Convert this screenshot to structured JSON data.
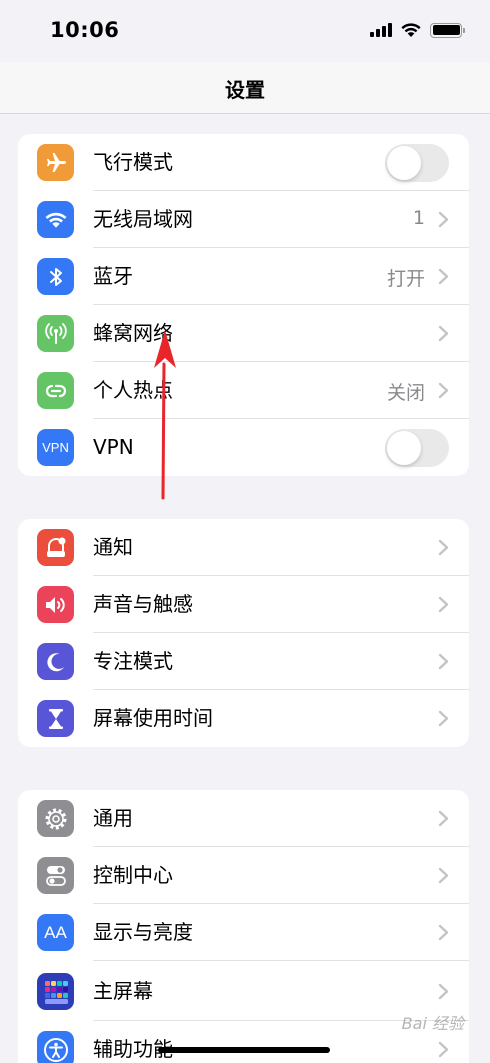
{
  "status_bar": {
    "time": "10:06"
  },
  "nav": {
    "title": "设置"
  },
  "colors": {
    "airplane": "#f19a38",
    "wifi": "#3478f6",
    "bluetooth": "#3478f6",
    "cellular": "#65c466",
    "hotspot": "#65c466",
    "vpn": "#3478f6",
    "notifications": "#eb4e3d",
    "sounds": "#eb445a",
    "focus": "#5856d6",
    "screen_time": "#5856d6",
    "general": "#8e8e93",
    "control_center": "#8e8e93",
    "display": "#3478f6",
    "home_screen": "#2c3db8",
    "accessibility": "#3478f6",
    "arrow": "#e8252a"
  },
  "group1": [
    {
      "label": "飞行模式",
      "icon": "airplane-icon",
      "control": "toggle",
      "on": false
    },
    {
      "label": "无线局域网",
      "icon": "wifi-icon",
      "value": "1"
    },
    {
      "label": "蓝牙",
      "icon": "bluetooth-icon",
      "value": "打开"
    },
    {
      "label": "蜂窝网络",
      "icon": "cellular-icon",
      "value": ""
    },
    {
      "label": "个人热点",
      "icon": "hotspot-icon",
      "value": "关闭"
    },
    {
      "label": "VPN",
      "icon": "vpn-icon",
      "icon_text": "VPN",
      "control": "toggle",
      "on": false
    }
  ],
  "group2": [
    {
      "label": "通知",
      "icon": "notifications-icon"
    },
    {
      "label": "声音与触感",
      "icon": "sounds-icon"
    },
    {
      "label": "专注模式",
      "icon": "moon-icon"
    },
    {
      "label": "屏幕使用时间",
      "icon": "hourglass-icon"
    }
  ],
  "group3": [
    {
      "label": "通用",
      "icon": "gear-icon"
    },
    {
      "label": "控制中心",
      "icon": "switches-icon"
    },
    {
      "label": "显示与亮度",
      "icon": "text-size-icon",
      "icon_text": "AA"
    },
    {
      "label": "主屏幕",
      "icon": "home-grid-icon"
    },
    {
      "label": "辅助功能",
      "icon": "accessibility-icon"
    }
  ],
  "watermark": "Bai 经验"
}
